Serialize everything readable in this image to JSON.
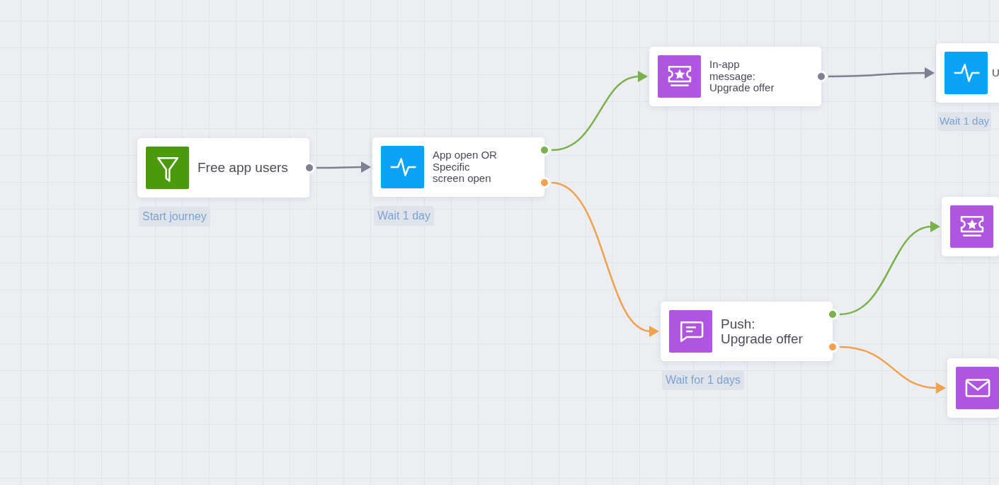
{
  "nodes": [
    {
      "kind": "filter",
      "title": [
        "Free app users"
      ],
      "label": "Start journey",
      "ports": [
        {
          "color": "#7b8190"
        }
      ]
    },
    {
      "kind": "pulse",
      "title": [
        "App open OR",
        "Specific",
        "screen open"
      ],
      "label": "Wait 1 day",
      "ports": [
        {
          "color": "#79b14a"
        },
        {
          "color": "#f0a24f"
        }
      ]
    },
    {
      "kind": "ticket",
      "title": [
        "In-app",
        "message:",
        "Upgrade offer"
      ],
      "ports": [
        {
          "color": "#7b8190"
        }
      ]
    },
    {
      "kind": "pulse",
      "title": [
        "U"
      ],
      "label": "Wait 1 day"
    },
    {
      "kind": "ticket"
    },
    {
      "kind": "chat",
      "title": [
        "Push:",
        "Upgrade offer"
      ],
      "label": "Wait for 1 days",
      "ports": [
        {
          "color": "#79b14a"
        },
        {
          "color": "#f0a24f"
        }
      ]
    },
    {
      "kind": "mail"
    }
  ]
}
